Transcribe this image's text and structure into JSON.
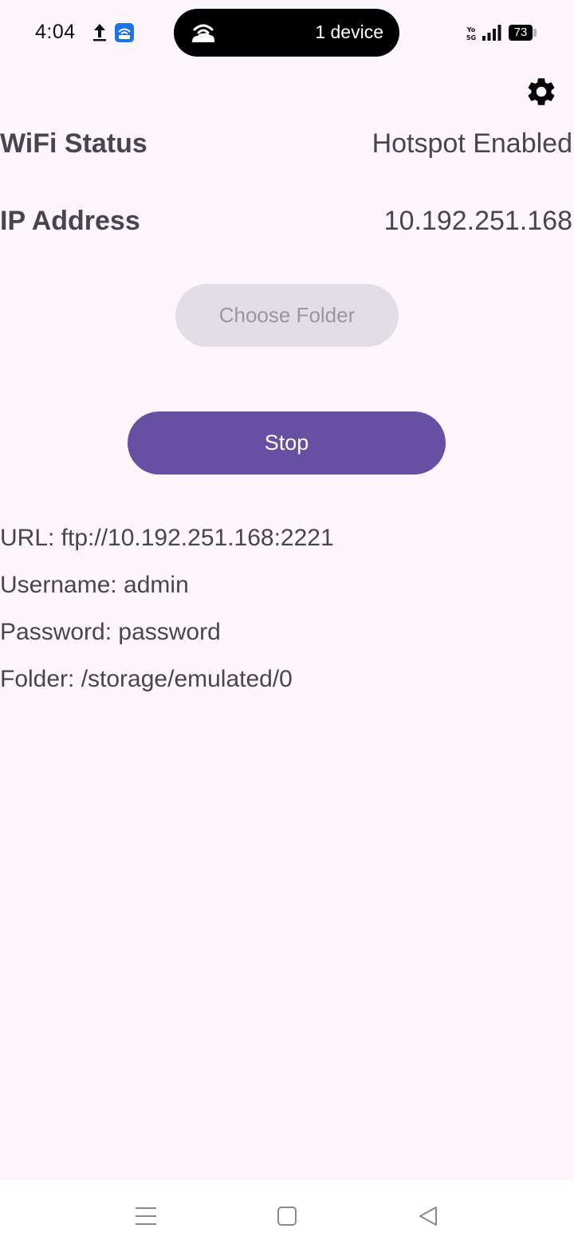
{
  "status_bar": {
    "time": "4:04",
    "island_text": "1 device",
    "battery_level": "73"
  },
  "wifi_status": {
    "label": "WiFi Status",
    "value": "Hotspot Enabled"
  },
  "ip_address": {
    "label": "IP Address",
    "value": "10.192.251.168"
  },
  "buttons": {
    "choose_folder": "Choose Folder",
    "stop": "Stop"
  },
  "details": {
    "url": "URL: ftp://10.192.251.168:2221",
    "username": "Username: admin",
    "password": "Password: password",
    "folder": "Folder: /storage/emulated/0"
  },
  "colors": {
    "background": "#fdf7fd",
    "primary": "#6750a4",
    "disabled_button": "#e3dde5",
    "text": "#48454e"
  }
}
